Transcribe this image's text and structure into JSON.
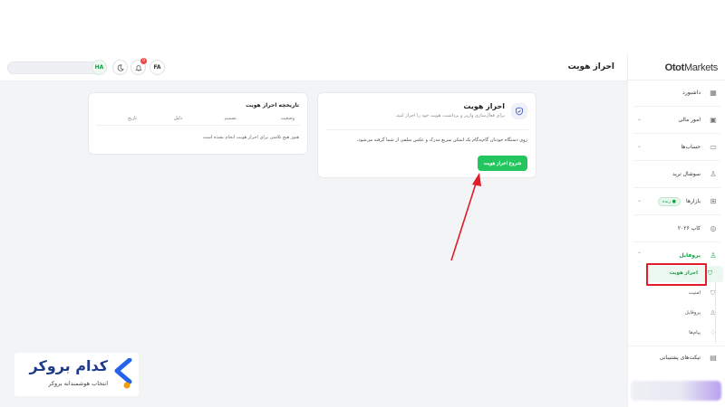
{
  "header": {
    "title": "احراز هویت",
    "avatar_initials": "HA",
    "notification_count": "0",
    "language": "FA"
  },
  "sidebar": {
    "logo_prefix": "Otot",
    "logo_suffix": "Markets",
    "items": [
      {
        "label": "داشبورد",
        "icon": "dashboard-icon"
      },
      {
        "label": "امور مالی",
        "icon": "wallet-icon"
      },
      {
        "label": "حساب‌ها",
        "icon": "accounts-icon"
      },
      {
        "label": "سوشال ترید",
        "icon": "social-trade-icon"
      },
      {
        "label": "بازارها",
        "icon": "markets-icon",
        "badge": "● زنده"
      },
      {
        "label": "کاپ ۲۰۲۶",
        "icon": "cup-icon"
      },
      {
        "label": "پروفایل",
        "icon": "user-icon"
      }
    ],
    "profile_sub": [
      {
        "label": "احراز هویت",
        "icon": "shield-icon"
      },
      {
        "label": "امنیت",
        "icon": "lock-icon"
      },
      {
        "label": "پروفایل",
        "icon": "user-icon"
      },
      {
        "label": "پیام‌ها",
        "icon": "bell-icon"
      }
    ],
    "support": {
      "label": "تیکت‌های پشتیبانی",
      "icon": "ticket-icon"
    }
  },
  "verify_card": {
    "title": "احراز هویت",
    "subtitle": "برای فعال‌سازی واریز و برداشت، هویت خود را احراز کنید.",
    "description": "روی دستگاه خودتان گام‌به‌گام یک اسکن سریع مدرک و عکس سلفی از شما گرفته می‌شود.",
    "button_label": "شروع احراز هویت"
  },
  "history_card": {
    "title": "تاریخچه احراز هویت",
    "columns": [
      "وضعیت",
      "تصمیم",
      "دلیل",
      "تاریخ"
    ],
    "empty_text": "هنوز هیچ تلاشی برای احراز هویت انجام نشده است"
  },
  "brand": {
    "name": "کدام بروکر",
    "tagline": "انتخاب هوشمندانه بروکر"
  },
  "colors": {
    "accent": "#22c55e",
    "annotation": "#e11d2b",
    "brand": "#1e3a8a"
  }
}
